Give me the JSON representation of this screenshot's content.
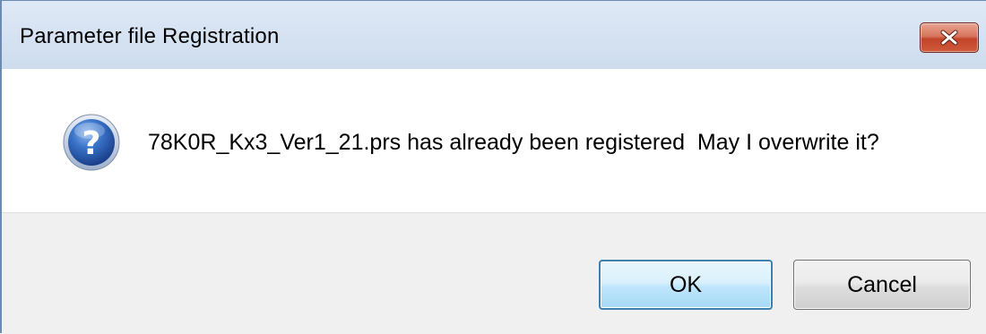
{
  "window": {
    "title": "Parameter file Registration",
    "close_icon": "close-icon"
  },
  "message": {
    "icon": "question-icon",
    "text": "78K0R_Kx3_Ver1_21.prs has already been registered  May I overwrite it?"
  },
  "buttons": {
    "ok_label": "OK",
    "cancel_label": "Cancel"
  },
  "colors": {
    "titlebar": "#d6e3f3",
    "close_button": "#c7452b",
    "icon_blue": "#2a5db0",
    "ok_border": "#3c7fb1",
    "footer_bg": "#f0f0f0"
  }
}
